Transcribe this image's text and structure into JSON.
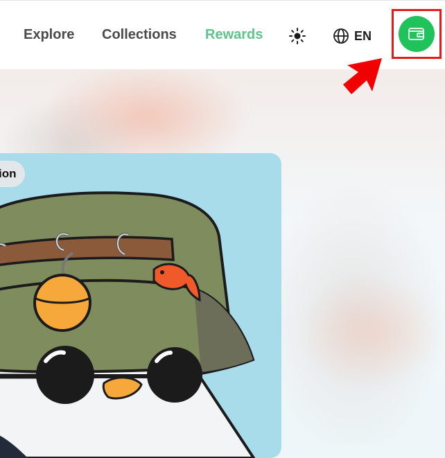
{
  "header": {
    "nav": [
      {
        "label": "Explore"
      },
      {
        "label": "Collections"
      },
      {
        "label": "Rewards"
      }
    ],
    "theme_icon": "sun-icon",
    "language": {
      "icon": "globe-icon",
      "label": "EN"
    },
    "wallet_icon": "wallet-icon"
  },
  "card": {
    "badge_label": "ion",
    "image": "penguin-bucket-hat-artwork"
  },
  "annotation": {
    "highlight_color": "#e21b1b",
    "arrow_color": "#f00000"
  },
  "colors": {
    "accent": "#5ec48a",
    "wallet_bg": "#1fc25b",
    "card_bg": "#a9dceb"
  }
}
